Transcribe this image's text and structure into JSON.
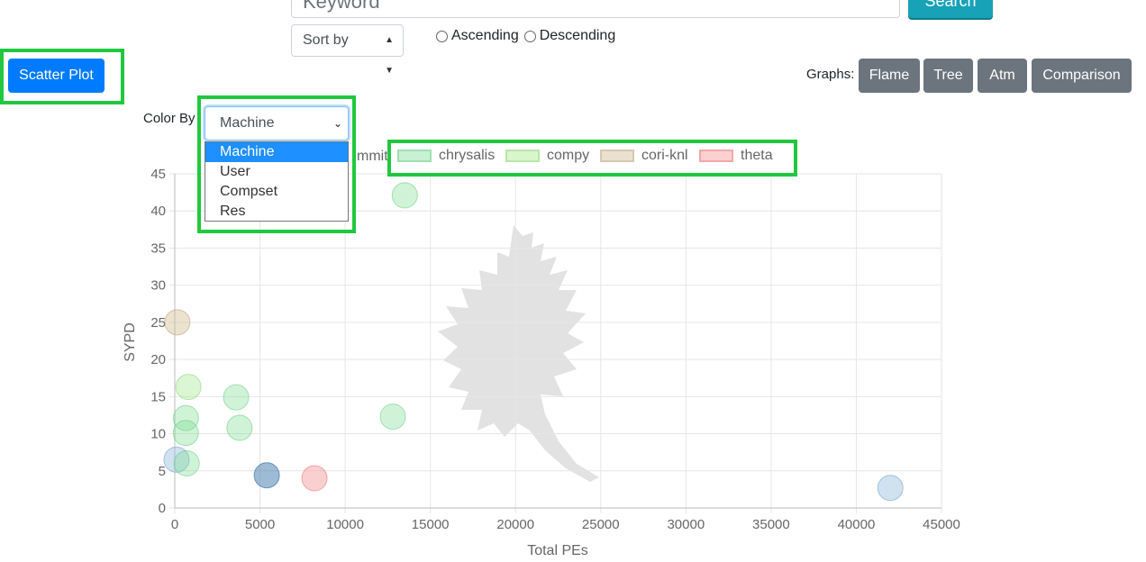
{
  "search": {
    "placeholder": "Keyword",
    "button_label": "Search"
  },
  "sort": {
    "select_label": "Sort by",
    "ascending": "Ascending",
    "descending": "Descending"
  },
  "scatter_button": "Scatter Plot",
  "graphs": {
    "label": "Graphs:",
    "buttons": [
      "Flame",
      "Tree",
      "Atm",
      "Comparison"
    ]
  },
  "color_by": {
    "label": "Color By",
    "selected": "Machine",
    "options": [
      "Machine",
      "User",
      "Compset",
      "Res"
    ]
  },
  "legend": {
    "partial_label": "mmit",
    "items": [
      {
        "label": "chrysalis",
        "fill": "#c9f0d3",
        "border": "#9fe0b0"
      },
      {
        "label": "compy",
        "fill": "#d8f5cc",
        "border": "#b9e8a8"
      },
      {
        "label": "cori-knl",
        "fill": "#eae0d0",
        "border": "#d8c8ae"
      },
      {
        "label": "theta",
        "fill": "#fbd0d0",
        "border": "#f4a8a8"
      }
    ]
  },
  "chart_data": {
    "type": "scatter",
    "xlabel": "Total PEs",
    "ylabel": "SYPD",
    "xlim": [
      0,
      45000
    ],
    "ylim": [
      0,
      45
    ],
    "x_ticks": [
      0,
      5000,
      10000,
      15000,
      20000,
      25000,
      30000,
      35000,
      40000,
      45000
    ],
    "y_ticks": [
      0,
      5,
      10,
      15,
      20,
      25,
      30,
      35,
      40,
      45
    ],
    "grid": true,
    "points": [
      {
        "x": 13500,
        "y": 42.1,
        "fill": "rgba(120,220,140,0.35)",
        "stroke": "rgba(90,200,120,0.5)"
      },
      {
        "x": 150,
        "y": 25.0,
        "fill": "rgba(210,190,150,0.45)",
        "stroke": "rgba(190,165,120,0.6)"
      },
      {
        "x": 800,
        "y": 16.3,
        "fill": "rgba(150,230,130,0.35)",
        "stroke": "rgba(120,210,100,0.5)"
      },
      {
        "x": 3600,
        "y": 14.9,
        "fill": "rgba(120,220,140,0.35)",
        "stroke": "rgba(90,200,120,0.5)"
      },
      {
        "x": 650,
        "y": 12.1,
        "fill": "rgba(120,220,140,0.35)",
        "stroke": "rgba(90,200,120,0.5)"
      },
      {
        "x": 12800,
        "y": 12.3,
        "fill": "rgba(120,220,140,0.35)",
        "stroke": "rgba(90,200,120,0.5)"
      },
      {
        "x": 3800,
        "y": 10.8,
        "fill": "rgba(120,220,140,0.35)",
        "stroke": "rgba(90,200,120,0.5)"
      },
      {
        "x": 650,
        "y": 10.1,
        "fill": "rgba(120,220,140,0.35)",
        "stroke": "rgba(90,200,120,0.5)"
      },
      {
        "x": 100,
        "y": 6.5,
        "fill": "rgba(150,190,220,0.45)",
        "stroke": "rgba(120,165,200,0.6)"
      },
      {
        "x": 700,
        "y": 6.0,
        "fill": "rgba(120,220,140,0.35)",
        "stroke": "rgba(90,200,120,0.5)"
      },
      {
        "x": 5400,
        "y": 4.4,
        "fill": "rgba(60,120,170,0.5)",
        "stroke": "rgba(60,120,170,0.7)"
      },
      {
        "x": 8200,
        "y": 4.0,
        "fill": "rgba(245,160,160,0.5)",
        "stroke": "rgba(235,130,130,0.65)"
      },
      {
        "x": 42000,
        "y": 2.7,
        "fill": "rgba(150,190,220,0.45)",
        "stroke": "rgba(120,165,200,0.6)"
      }
    ]
  }
}
